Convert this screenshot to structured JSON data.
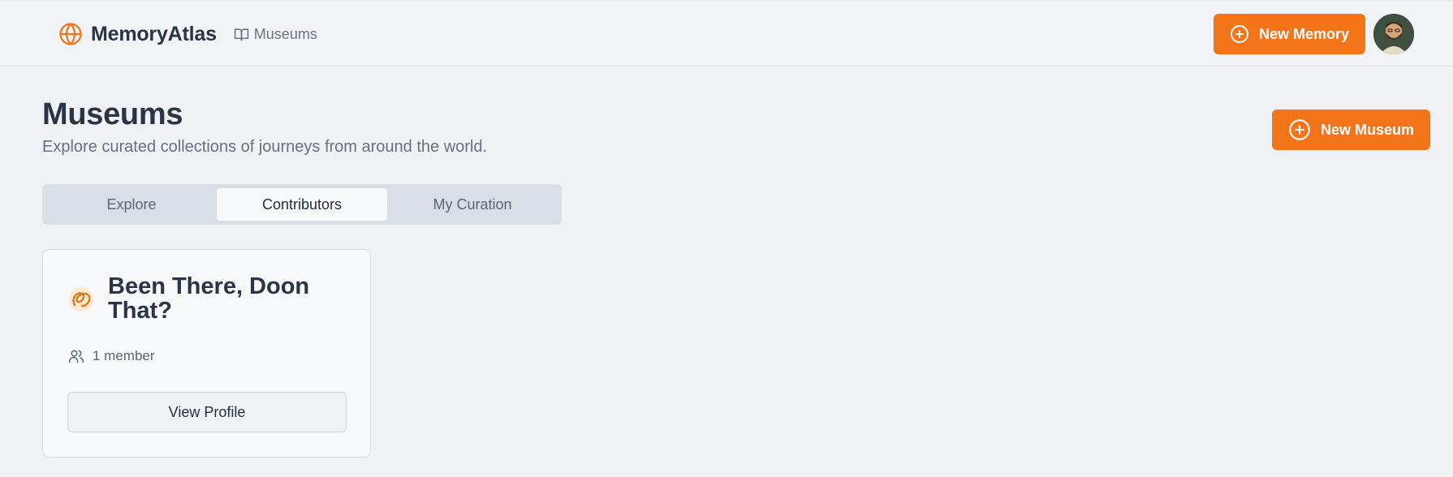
{
  "app": {
    "name": "MemoryAtlas",
    "brand_icon": "globe-icon",
    "accent_color": "#f47519"
  },
  "nav": {
    "breadcrumb_label": "Museums",
    "breadcrumb_icon": "book-open-icon",
    "new_memory_label": "New Memory"
  },
  "page": {
    "title": "Museums",
    "subtitle": "Explore curated collections of journeys from around the world.",
    "new_museum_label": "New Museum"
  },
  "tabs": [
    {
      "label": "Explore",
      "active": false
    },
    {
      "label": "Contributors",
      "active": true
    },
    {
      "label": "My Curation",
      "active": false
    }
  ],
  "cards": [
    {
      "title": "Been There, Doon That?",
      "members": "1 member",
      "action_label": "View Profile"
    }
  ]
}
